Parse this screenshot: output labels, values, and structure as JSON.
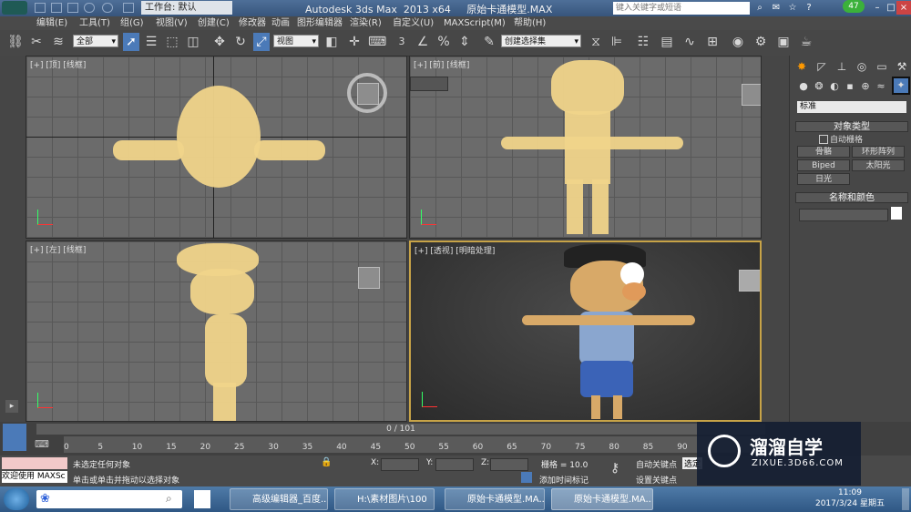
{
  "title_bar": {
    "workspace": "工作台: 默认",
    "title": "Autodesk 3ds Max  2013 x64     原始卡通模型.MAX",
    "search_placeholder": "键入关键字或短语",
    "badge": "47"
  },
  "menu": [
    "编辑(E)",
    "工具(T)",
    "组(G)",
    "视图(V)",
    "创建(C)",
    "修改器",
    "动画",
    "图形编辑器",
    "渲染(R)",
    "自定义(U)",
    "MAXScript(M)",
    "帮助(H)"
  ],
  "toolbar": {
    "filter": "全部",
    "ref_coord": "视图",
    "snap_label": "3",
    "selection_set": "创建选择集"
  },
  "viewports": [
    {
      "label": "[+] [顶] [线框]"
    },
    {
      "label": "[+] [前] [线框]"
    },
    {
      "label": "[+] [左] [线框]"
    },
    {
      "label": "[+] [透视] [明暗处理]"
    }
  ],
  "command_panel": {
    "category": "标准",
    "object_type_title": "对象类型",
    "autogrid": "自动栅格",
    "buttons": [
      "骨骼",
      "环形阵列",
      "Biped",
      "太阳光",
      "日光"
    ],
    "name_color_title": "名称和颜色"
  },
  "timeline": {
    "frame": "0 / 101",
    "ticks": [
      "0",
      "5",
      "10",
      "15",
      "20",
      "25",
      "30",
      "35",
      "40",
      "45",
      "50",
      "55",
      "60",
      "65",
      "70",
      "75",
      "80",
      "85",
      "90"
    ]
  },
  "status": {
    "script_listener": "欢迎使用 MAXSc",
    "line1": "未选定任何对象",
    "line2": "单击或单击并拖动以选择对象",
    "x_label": "X:",
    "y_label": "Y:",
    "z_label": "Z:",
    "grid": "栅格 = 10.0",
    "auto_key": "自动关键点",
    "set_key": "设置关键点",
    "add_time_tag": "添加时间标记",
    "selected": "选定"
  },
  "taskbar": {
    "items": [
      "高级编辑器_百度...",
      "H:\\素材图片\\100",
      "原始卡通模型.MA...",
      "原始卡通模型.MA..."
    ],
    "time": "11:09",
    "date": "2017/3/24 星期五"
  },
  "watermark": {
    "brand": "溜溜自学",
    "site": "ZIXUE.3D66.COM"
  }
}
